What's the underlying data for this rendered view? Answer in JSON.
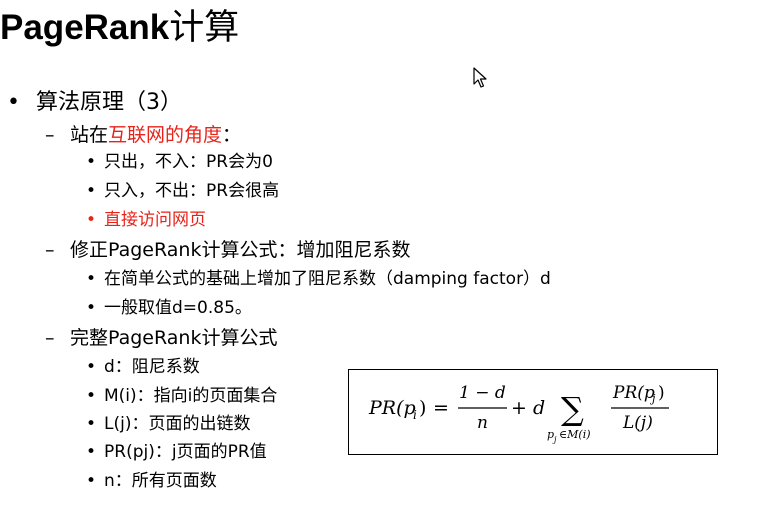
{
  "slide": {
    "title_latin": "PageRank",
    "title_cn": "计算"
  },
  "outline": {
    "l1": {
      "bullet": "•",
      "text": "算法原理（3）"
    },
    "section1": {
      "dash": "–",
      "prefix": "站在",
      "highlight": "互联网的角度",
      "suffix": "：",
      "items": [
        "只出，不入：PR会为0",
        "只入，不出：PR会很高",
        "直接访问网页"
      ]
    },
    "section2": {
      "dash": "–",
      "text": "修正PageRank计算公式：增加阻尼系数",
      "items": [
        "在简单公式的基础上增加了阻尼系数（damping factor）d",
        "一般取值d=0.85。"
      ]
    },
    "section3": {
      "dash": "–",
      "text": "完整PageRank计算公式",
      "items": [
        "d：阻尼系数",
        "M(i)：指向i的页面集合",
        "L(j)：页面的出链数",
        "PR(pj)：j页面的PR值",
        "n：所有页面数"
      ]
    },
    "sub_bullet": "•"
  },
  "formula": {
    "lhs": "PR(p",
    "lhs_sub": "i",
    "lhs_close": ")",
    "equals": "=",
    "frac1_num": "1 − d",
    "frac1_den": "n",
    "plus_d": "+ d",
    "sum": "∑",
    "sum_sub": "p",
    "sum_sub_j": "j",
    "sum_sub_rest": "∈M(i)",
    "frac2_num": "PR(p",
    "frac2_num_sub": "j",
    "frac2_num_close": ")",
    "frac2_den": "L(j)"
  },
  "colors": {
    "highlight": "#e8231a",
    "text": "#000000"
  },
  "cursor_icon": "mouse-pointer-icon"
}
